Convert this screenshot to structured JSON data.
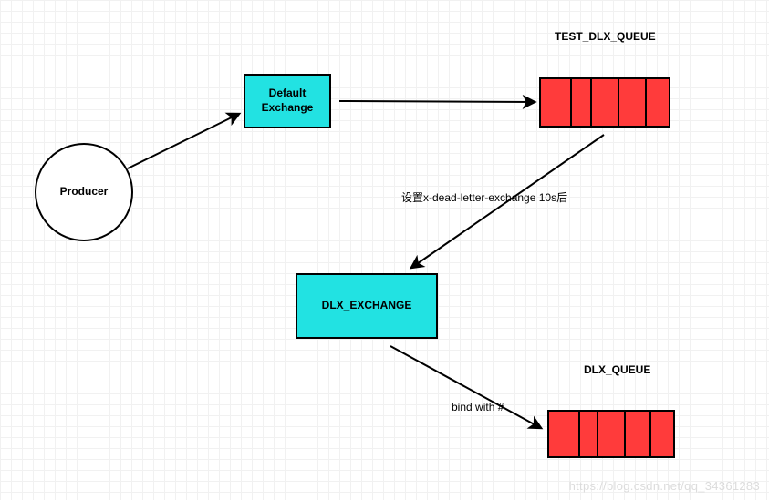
{
  "nodes": {
    "producer": {
      "label": "Producer"
    },
    "default_exchange": {
      "label_l1": "Default",
      "label_l2": "Exchange"
    },
    "dlx_exchange": {
      "label": "DLX_EXCHANGE"
    }
  },
  "queues": {
    "test_dlx_queue": {
      "title": "TEST_DLX_QUEUE",
      "segments": 5
    },
    "dlx_queue": {
      "title": "DLX_QUEUE",
      "segments": 5
    }
  },
  "edges": {
    "dead_letter": {
      "label": "设置x-dead-letter-exchange 10s后"
    },
    "bind": {
      "label": "bind with #"
    }
  },
  "watermark": "https://blog.csdn.net/qq_34361283"
}
